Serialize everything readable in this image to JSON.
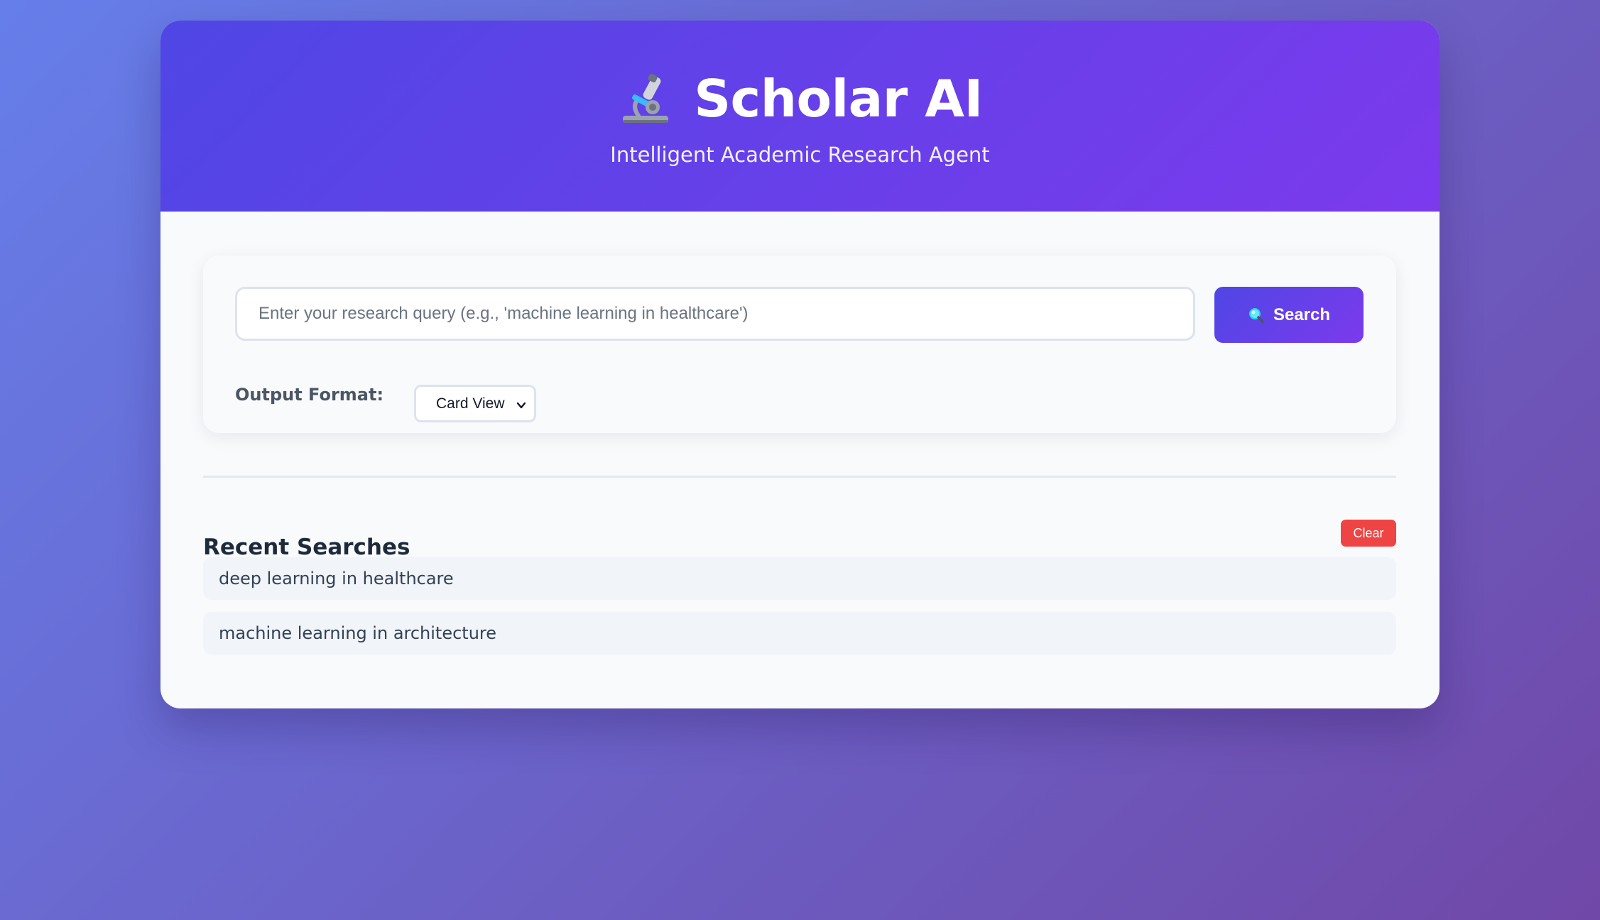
{
  "header": {
    "title": "Scholar AI",
    "subtitle": "Intelligent Academic Research Agent",
    "logo_icon": "microscope-icon"
  },
  "search": {
    "placeholder": "Enter your research query (e.g., 'machine learning in healthcare')",
    "value": "",
    "button_label": "Search",
    "button_icon": "magnifier-icon"
  },
  "format": {
    "label": "Output Format:",
    "selected": "Card View"
  },
  "recent": {
    "title": "Recent Searches",
    "clear_label": "Clear",
    "items": [
      "deep learning in healthcare",
      "machine learning in architecture"
    ]
  },
  "colors": {
    "accent_start": "#4f46e5",
    "accent_end": "#7c3aed",
    "danger": "#ef4444",
    "page_bg_start": "#667eea",
    "page_bg_end": "#7048a8"
  }
}
